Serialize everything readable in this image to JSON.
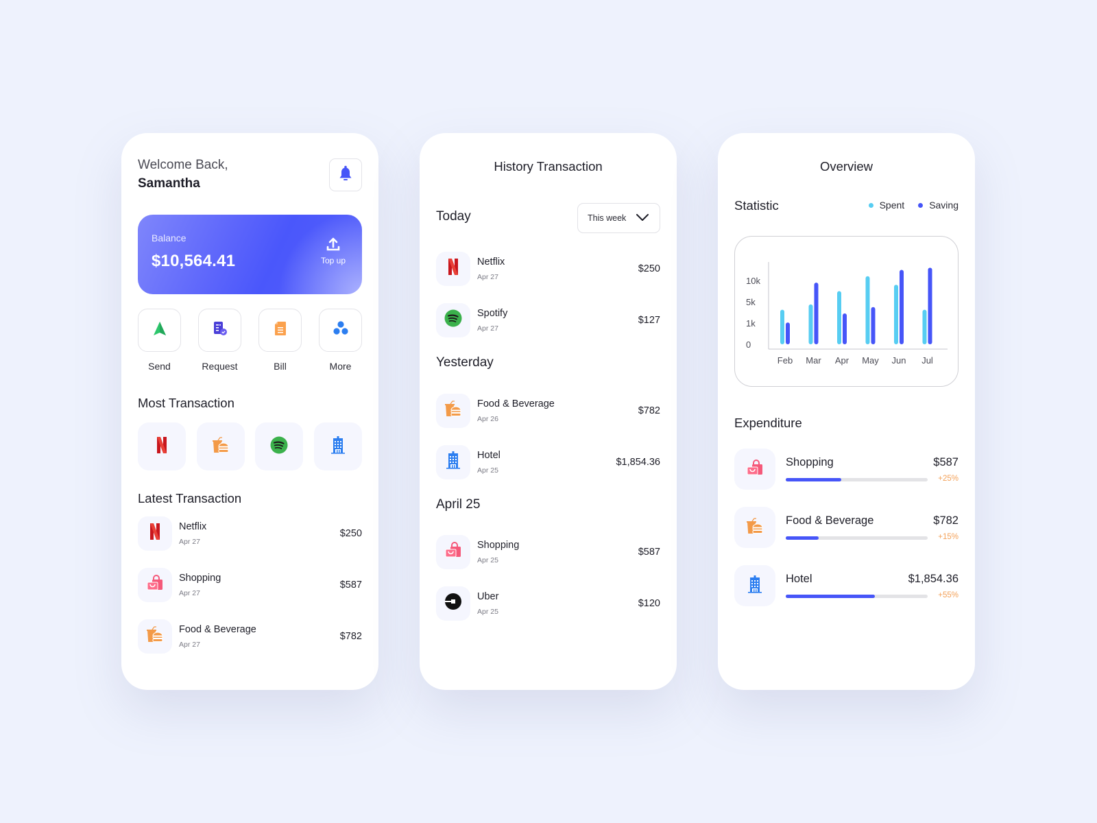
{
  "colors": {
    "accent": "#4655f8",
    "spent": "#57cdf2",
    "saving": "#4655f8",
    "positive_change": "#f3a057"
  },
  "home": {
    "welcome": "Welcome Back,",
    "username": "Samantha",
    "notification_icon": "bell-icon",
    "balance": {
      "label": "Balance",
      "value": "$10,564.41",
      "topup_label": "Top up",
      "topup_icon": "upload-icon"
    },
    "actions": [
      {
        "label": "Send",
        "icon": "send-icon"
      },
      {
        "label": "Request",
        "icon": "request-document-icon"
      },
      {
        "label": "Bill",
        "icon": "bill-icon"
      },
      {
        "label": "More",
        "icon": "more-icon"
      }
    ],
    "most_transaction": {
      "title": "Most Transaction",
      "items": [
        {
          "name": "Netflix",
          "icon": "netflix-icon"
        },
        {
          "name": "Food & Beverage",
          "icon": "food-beverage-icon"
        },
        {
          "name": "Spotify",
          "icon": "spotify-icon"
        },
        {
          "name": "Hotel",
          "icon": "hotel-icon"
        }
      ]
    },
    "latest_transaction": {
      "title": "Latest Transaction",
      "items": [
        {
          "name": "Netflix",
          "date": "Apr 27",
          "amount": "$250",
          "icon": "netflix-icon"
        },
        {
          "name": "Shopping",
          "date": "Apr 27",
          "amount": "$587",
          "icon": "shopping-icon"
        },
        {
          "name": "Food & Beverage",
          "date": "Apr 27",
          "amount": "$782",
          "icon": "food-beverage-icon"
        }
      ]
    }
  },
  "history": {
    "title": "History Transaction",
    "filter": {
      "selected": "This week"
    },
    "groups": [
      {
        "title": "Today",
        "items": [
          {
            "name": "Netflix",
            "date": "Apr 27",
            "amount": "$250",
            "icon": "netflix-icon"
          },
          {
            "name": "Spotify",
            "date": "Apr 27",
            "amount": "$127",
            "icon": "spotify-icon"
          }
        ]
      },
      {
        "title": "Yesterday",
        "items": [
          {
            "name": "Food & Beverage",
            "date": "Apr 26",
            "amount": "$782",
            "icon": "food-beverage-icon"
          },
          {
            "name": "Hotel",
            "date": "Apr 25",
            "amount": "$1,854.36",
            "icon": "hotel-icon"
          }
        ]
      },
      {
        "title": "April 25",
        "items": [
          {
            "name": "Shopping",
            "date": "Apr 25",
            "amount": "$587",
            "icon": "shopping-icon"
          },
          {
            "name": "Uber",
            "date": "Apr 25",
            "amount": "$120",
            "icon": "uber-icon"
          }
        ]
      }
    ]
  },
  "overview": {
    "title": "Overview",
    "statistic_title": "Statistic",
    "legend": [
      {
        "label": "Spent",
        "color": "#57cdf2"
      },
      {
        "label": "Saving",
        "color": "#4655f8"
      }
    ],
    "expenditure": {
      "title": "Expenditure",
      "items": [
        {
          "name": "Shopping",
          "amount": "$587",
          "change": "+25%",
          "progress": 0.39,
          "icon": "shopping-icon"
        },
        {
          "name": "Food & Beverage",
          "amount": "$782",
          "change": "+15%",
          "progress": 0.23,
          "icon": "food-beverage-icon"
        },
        {
          "name": "Hotel",
          "amount": "$1,854.36",
          "change": "+55%",
          "progress": 0.63,
          "icon": "hotel-icon"
        }
      ]
    }
  },
  "chart_data": {
    "type": "bar",
    "title": "Statistic",
    "xlabel": "",
    "ylabel": "",
    "categories": [
      "Feb",
      "Mar",
      "Apr",
      "May",
      "Jun",
      "Jul"
    ],
    "y_ticks": [
      "0",
      "1k",
      "5k",
      "10k"
    ],
    "y_scale": "ordinal-tick (evenly spaced 0, 1k, 5k, 10k)",
    "series": [
      {
        "name": "Spent",
        "color": "#57cdf2",
        "values": [
          3500,
          4500,
          7500,
          11000,
          9000,
          3500
        ]
      },
      {
        "name": "Saving",
        "color": "#4655f8",
        "values": [
          1100,
          9500,
          2800,
          4000,
          12500,
          13000
        ]
      }
    ],
    "grid": false,
    "legend": "top-right"
  }
}
